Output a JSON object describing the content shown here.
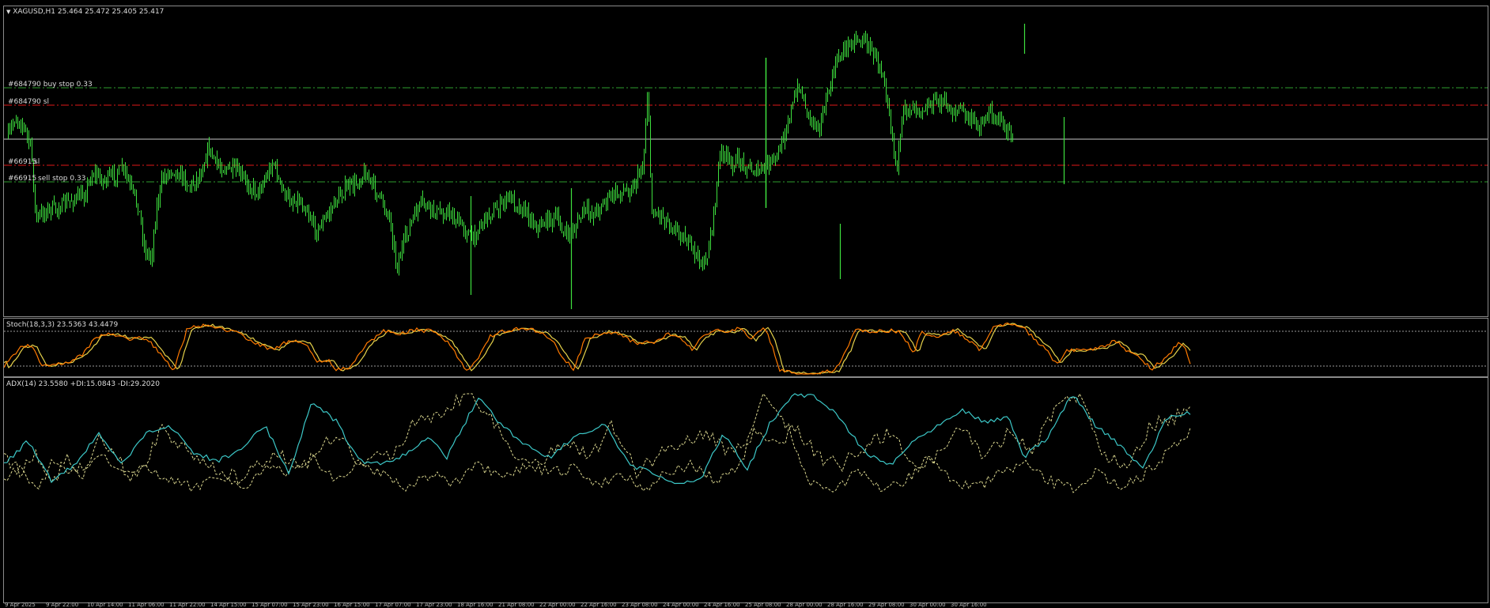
{
  "header": {
    "arrow": "▼",
    "title": "XAGUSD,H1  25.464 25.472 25.405 25.417"
  },
  "orders": [
    {
      "label": "#684790 buy stop 0.33",
      "color": "#2e9e2e"
    },
    {
      "label": "#684790 sl",
      "color": "#e01818"
    },
    {
      "label": "#66915",
      "color": "#e01818"
    },
    {
      "label": "sl",
      "color": "#e01818"
    },
    {
      "label": "#66915",
      "color": "#2e9e2e"
    },
    {
      "label": "sell stop 0.33",
      "color": "#2e9e2e"
    }
  ],
  "stoch": {
    "label": "Stoch(18,3,3) 23.5363 43.4479",
    "main_color": "#ff7a00",
    "signal_color": "#e6d24a"
  },
  "adx": {
    "label": "ADX(14) 23.5580 +DI:15.0843 -DI:29.2020",
    "adx_color": "#3cc8c8",
    "di_color": "#dcd890"
  },
  "axis_labels": [
    "9 Apr 2025",
    "9 Apr 22:00",
    "10 Apr 14:00",
    "11 Apr 06:00",
    "11 Apr 22:00",
    "14 Apr 15:00",
    "15 Apr 07:00",
    "15 Apr 23:00",
    "16 Apr 15:00",
    "17 Apr 07:00",
    "17 Apr 23:00",
    "18 Apr 16:00",
    "21 Apr 08:00",
    "22 Apr 00:00",
    "22 Apr 16:00",
    "23 Apr 08:00",
    "24 Apr 00:00",
    "24 Apr 16:00",
    "25 Apr 08:00",
    "28 Apr 00:00",
    "28 Apr 16:00",
    "29 Apr 08:00",
    "30 Apr 00:00",
    "30 Apr 16:00"
  ],
  "colors": {
    "candles": "#3ee03e",
    "price_line": "#c8c8c8",
    "border": "#8a8a8a"
  }
}
